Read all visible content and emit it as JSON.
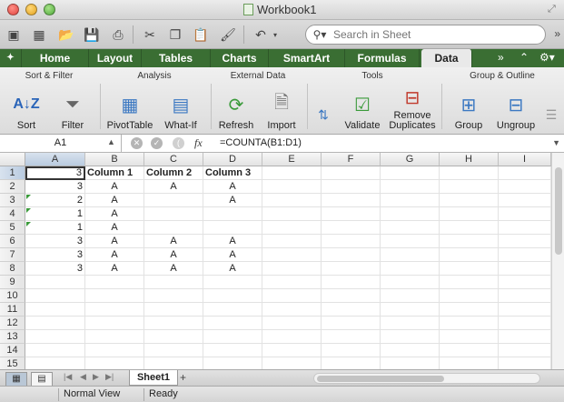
{
  "window": {
    "title": "Workbook1"
  },
  "toolbar": {
    "search_placeholder": "Search in Sheet"
  },
  "tabs": [
    {
      "label": "Home",
      "active": false
    },
    {
      "label": "Layout",
      "active": false
    },
    {
      "label": "Tables",
      "active": false
    },
    {
      "label": "Charts",
      "active": false
    },
    {
      "label": "SmartArt",
      "active": false
    },
    {
      "label": "Formulas",
      "active": false
    },
    {
      "label": "Data",
      "active": true
    }
  ],
  "ribbon": {
    "groups": {
      "sort_filter": "Sort & Filter",
      "analysis": "Analysis",
      "external_data": "External Data",
      "tools": "Tools",
      "group_outline": "Group & Outline"
    },
    "buttons": {
      "sort": "Sort",
      "filter": "Filter",
      "pivottable": "PivotTable",
      "whatif": "What-If",
      "refresh": "Refresh",
      "import": "Import",
      "validate": "Validate",
      "remove_dup_1": "Remove",
      "remove_dup_2": "Duplicates",
      "group": "Group",
      "ungroup": "Ungroup"
    }
  },
  "formula_bar": {
    "name_box": "A1",
    "fx": "fx",
    "formula": "=COUNTA(B1:D1)"
  },
  "grid": {
    "columns": [
      "A",
      "B",
      "C",
      "D",
      "E",
      "F",
      "G",
      "H",
      "I"
    ],
    "rows": [
      "1",
      "2",
      "3",
      "4",
      "5",
      "6",
      "7",
      "8",
      "9",
      "10",
      "11",
      "12",
      "13",
      "14",
      "15"
    ],
    "cells": {
      "r1": [
        "3",
        "Column 1",
        "Column 2",
        "Column 3"
      ],
      "r2": [
        "3",
        "A",
        "A",
        "A"
      ],
      "r3": [
        "2",
        "A",
        "",
        "A"
      ],
      "r4": [
        "1",
        "A",
        "",
        ""
      ],
      "r5": [
        "1",
        "A",
        "",
        ""
      ],
      "r6": [
        "3",
        "A",
        "A",
        "A"
      ],
      "r7": [
        "3",
        "A",
        "A",
        "A"
      ],
      "r8": [
        "3",
        "A",
        "A",
        "A"
      ]
    },
    "active_cell": "A1"
  },
  "sheet_tabs": {
    "active": "Sheet1",
    "add": "+"
  },
  "status": {
    "view": "Normal View",
    "state": "Ready"
  },
  "colors": {
    "ribbon_tab_bg": "#3a6e33",
    "error_marker": "#3a9a3a"
  }
}
